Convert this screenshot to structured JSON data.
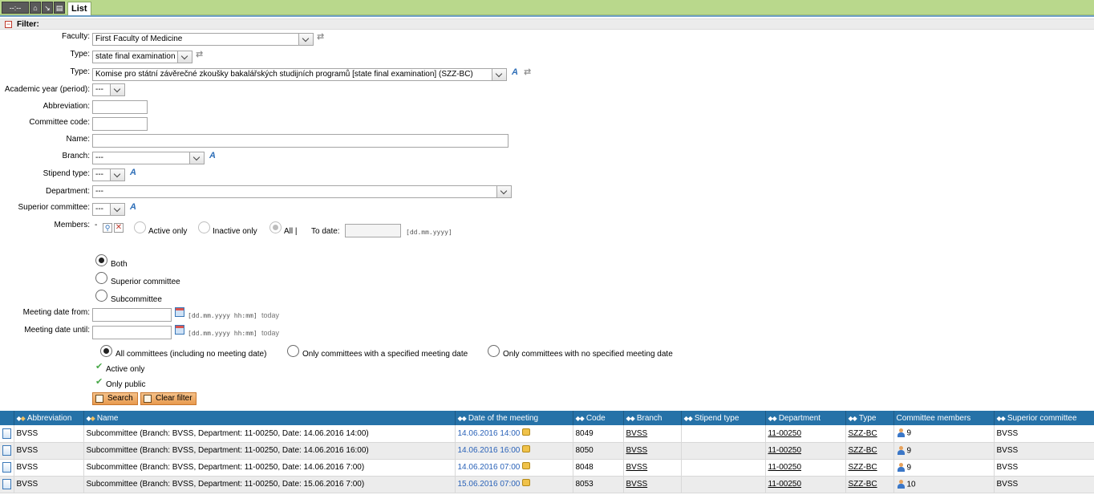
{
  "topbar": {
    "nav_label": "--:--",
    "tab_label": "List"
  },
  "filter": {
    "title": "Filter:",
    "faculty": {
      "label": "Faculty:",
      "value": "First Faculty of Medicine"
    },
    "type1": {
      "label": "Type:",
      "value": "state final examination"
    },
    "type2": {
      "label": "Type:",
      "value": "Komise pro státní závěrečné zkoušky bakalářských studijních programů [state final examination] (SZZ-BC)"
    },
    "academic_year": {
      "label": "Academic year (period):",
      "value": "---"
    },
    "abbreviation": {
      "label": "Abbreviation:",
      "value": ""
    },
    "committee_code": {
      "label": "Committee code:",
      "value": ""
    },
    "name": {
      "label": "Name:",
      "value": ""
    },
    "branch": {
      "label": "Branch:",
      "value": "---"
    },
    "stipend_type": {
      "label": "Stipend type:",
      "value": "---"
    },
    "department": {
      "label": "Department:",
      "value": "---"
    },
    "superior_committee": {
      "label": "Superior committee:",
      "value": "---"
    },
    "members": {
      "label": "Members:",
      "dash": "-",
      "active_only": "Active only",
      "inactive_only": "Inactive only",
      "all": "All |",
      "to_date_label": "To date:",
      "to_date_hint": "[dd.mm.yyyy]"
    },
    "level": {
      "both": "Both",
      "superior": "Superior committee",
      "sub": "Subcommittee",
      "selected": "both"
    },
    "meeting_from": {
      "label": "Meeting date from:",
      "hint": "[dd.mm.yyyy hh:mm]",
      "today": "today"
    },
    "meeting_until": {
      "label": "Meeting date until:",
      "hint": "[dd.mm.yyyy hh:mm]",
      "today": "today"
    },
    "meeting_scope": {
      "all": "All committees (including no meeting date)",
      "specified": "Only committees with a specified meeting date",
      "none": "Only committees with no specified meeting date",
      "selected": "all"
    },
    "active_only": "Active only",
    "only_public": "Only public",
    "search_button": "Search",
    "clear_button": "Clear filter"
  },
  "table": {
    "headers": [
      "Abbreviation",
      "Name",
      "Date of the meeting",
      "Code",
      "Branch",
      "Stipend type",
      "Department",
      "Type",
      "Committee members",
      "Superior committee"
    ],
    "rows": [
      {
        "abbr": "BVSS",
        "name": "Subcommittee (Branch: BVSS, Department: 11-00250, Date: 14.06.2016 14:00)",
        "date": "14.06.2016 14:00",
        "code": "8049",
        "branch": "BVSS",
        "stipend": "",
        "dept": "11-00250",
        "type": "SZZ-BC",
        "members": "9",
        "superior": "BVSS"
      },
      {
        "abbr": "BVSS",
        "name": "Subcommittee (Branch: BVSS, Department: 11-00250, Date: 14.06.2016 16:00)",
        "date": "14.06.2016 16:00",
        "code": "8050",
        "branch": "BVSS",
        "stipend": "",
        "dept": "11-00250",
        "type": "SZZ-BC",
        "members": "9",
        "superior": "BVSS"
      },
      {
        "abbr": "BVSS",
        "name": "Subcommittee (Branch: BVSS, Department: 11-00250, Date: 14.06.2016 7:00)",
        "date": "14.06.2016 07:00",
        "code": "8048",
        "branch": "BVSS",
        "stipend": "",
        "dept": "11-00250",
        "type": "SZZ-BC",
        "members": "9",
        "superior": "BVSS"
      },
      {
        "abbr": "BVSS",
        "name": "Subcommittee (Branch: BVSS, Department: 11-00250, Date: 15.06.2016 7:00)",
        "date": "15.06.2016 07:00",
        "code": "8053",
        "branch": "BVSS",
        "stipend": "",
        "dept": "11-00250",
        "type": "SZZ-BC",
        "members": "10",
        "superior": "BVSS"
      }
    ]
  },
  "colors": {
    "topbar": "#b9d88c",
    "header_bg": "#2672a8",
    "button": "#e89a4e",
    "link_date": "#2a62b8"
  },
  "icons": [
    "home-icon",
    "arrow-icon",
    "print-icon",
    "swap-icon",
    "translate-icon",
    "search-person-icon",
    "delete-icon",
    "calendar-icon",
    "check-icon",
    "search-icon",
    "trash-icon",
    "document-icon",
    "lock-icon",
    "person-icon",
    "sort-icon"
  ]
}
